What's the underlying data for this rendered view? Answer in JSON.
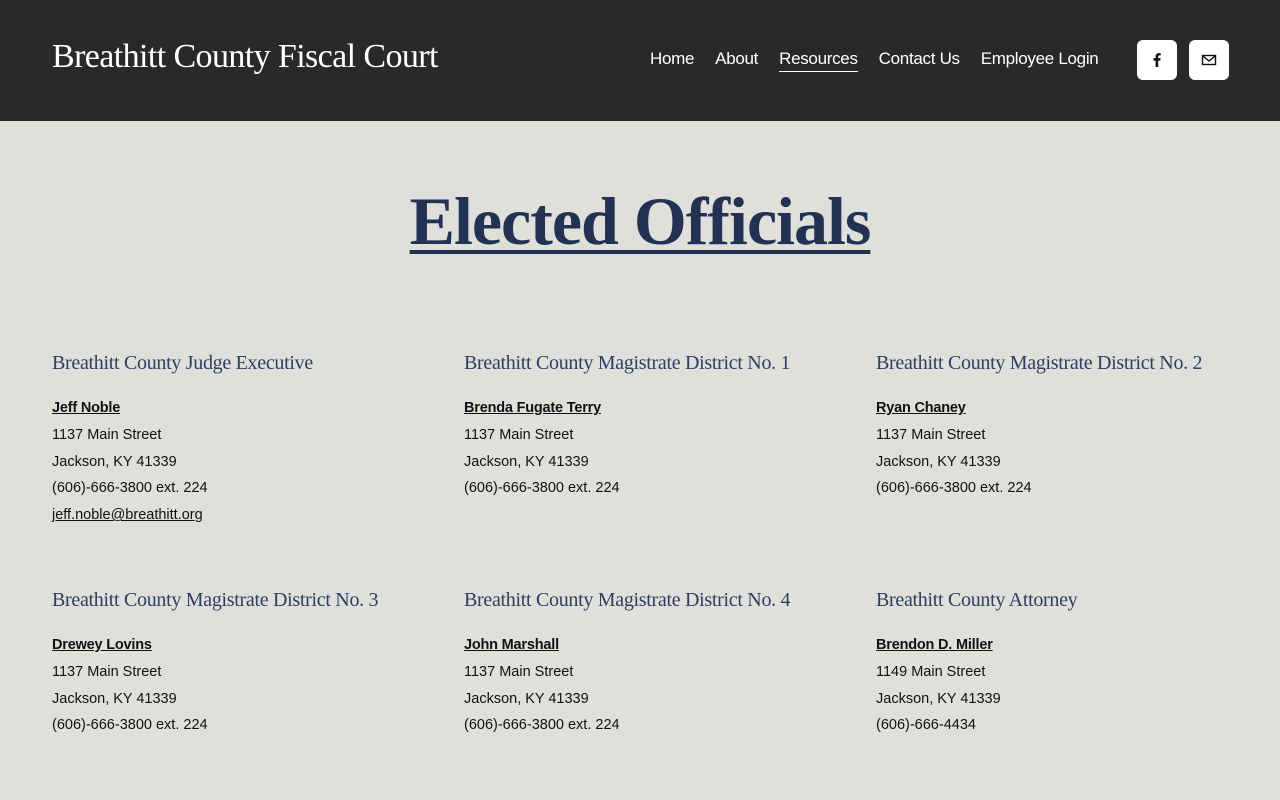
{
  "header": {
    "site_title": "Breathitt County Fiscal Court",
    "nav": [
      {
        "label": "Home",
        "active": false
      },
      {
        "label": "About",
        "active": false
      },
      {
        "label": "Resources",
        "active": true
      },
      {
        "label": "Contact Us",
        "active": false
      },
      {
        "label": "Employee Login",
        "active": false
      }
    ],
    "social_icons": [
      "facebook-icon",
      "mail-icon"
    ]
  },
  "main": {
    "title": "Elected Officials",
    "officials": [
      {
        "role": "Breathitt County Judge Executive",
        "name": "Jeff Noble",
        "street": "1137 Main Street",
        "city": "Jackson, KY 41339",
        "phone": "(606)-666-3800 ext. 224",
        "email": "jeff.noble@breathitt.org"
      },
      {
        "role": "Breathitt County Magistrate District No. 1",
        "name": "Brenda Fugate Terry",
        "street": "1137 Main Street",
        "city": "Jackson, KY 41339",
        "phone": "(606)-666-3800 ext. 224"
      },
      {
        "role": "Breathitt County Magistrate District No. 2",
        "name": "Ryan Chaney",
        "street": "1137 Main Street",
        "city": "Jackson, KY 41339",
        "phone": "(606)-666-3800 ext. 224"
      },
      {
        "role": "Breathitt County Magistrate District No. 3",
        "name": "Drewey Lovins",
        "street": "1137 Main Street",
        "city": "Jackson, KY 41339",
        "phone": "(606)-666-3800 ext. 224"
      },
      {
        "role": "Breathitt County Magistrate District No. 4",
        "name": "John Marshall",
        "street": "1137 Main Street",
        "city": "Jackson, KY 41339",
        "phone": "(606)-666-3800 ext. 224"
      },
      {
        "role": "Breathitt County Attorney",
        "name": "Brendon D. Miller",
        "street": "1149 Main Street",
        "city": "Jackson, KY 41339",
        "phone": "(606)-666-4434"
      }
    ]
  },
  "colors": {
    "header_bg": "#2a2829",
    "page_bg": "#dfe0db",
    "title_navy": "#233252",
    "role_navy": "#2d3e5e"
  }
}
